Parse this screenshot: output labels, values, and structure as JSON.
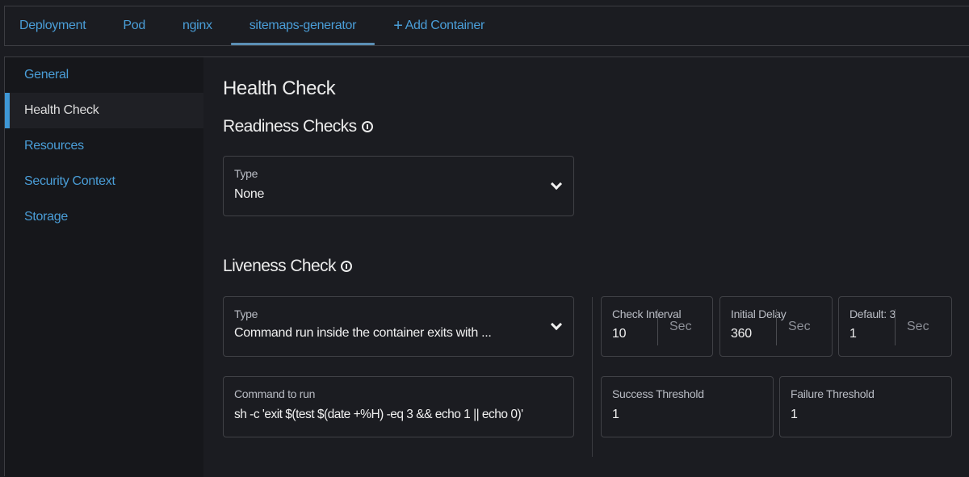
{
  "tabs": [
    {
      "label": "Deployment",
      "active": false
    },
    {
      "label": "Pod",
      "active": false
    },
    {
      "label": "nginx",
      "active": false
    },
    {
      "label": "sitemaps-generator",
      "active": true
    }
  ],
  "add_container": {
    "icon": "+",
    "label": "Add Container"
  },
  "sidebar": {
    "items": [
      {
        "label": "General"
      },
      {
        "label": "Health Check"
      },
      {
        "label": "Resources"
      },
      {
        "label": "Security Context"
      },
      {
        "label": "Storage"
      }
    ],
    "active_index": 1
  },
  "main": {
    "title": "Health Check",
    "readiness": {
      "heading": "Readiness Checks",
      "type_label": "Type",
      "type_value": "None"
    },
    "liveness": {
      "heading": "Liveness Check",
      "type_label": "Type",
      "type_value": "Command run inside the container exits with ...",
      "command_label": "Command to run",
      "command_value": "sh -c 'exit $(test $(date +%H) -eq 3 && echo 1 || echo 0)'",
      "check_interval": {
        "label": "Check Interval",
        "value": "10",
        "unit": "Sec"
      },
      "initial_delay": {
        "label": "Initial Delay",
        "value": "360",
        "unit": "Sec"
      },
      "timeout": {
        "label": "Default: 3",
        "value": "1",
        "unit": "Sec"
      },
      "success_threshold": {
        "label": "Success Threshold",
        "value": "1"
      },
      "failure_threshold": {
        "label": "Failure Threshold",
        "value": "1"
      }
    }
  },
  "colors": {
    "accent": "#4a9ed8",
    "active_indicator": "#3e97d6",
    "background": "#1b1c21",
    "sidebar_background": "#16171b"
  }
}
